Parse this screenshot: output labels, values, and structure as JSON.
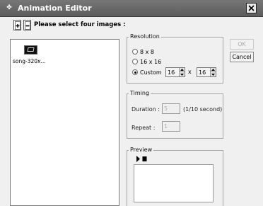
{
  "window": {
    "title": "Animation Editor",
    "title_icon": "animation-icon",
    "close_icon": "close-icon"
  },
  "toolbar": {
    "add_icon": "add-image-icon",
    "remove_icon": "remove-image-icon",
    "instruction": "Please select four images :"
  },
  "image_list": {
    "items": [
      {
        "label": "song-320x...",
        "icon": "image-thumbnail"
      }
    ]
  },
  "resolution": {
    "title": "Resolution",
    "options": [
      "8 x 8",
      "16 x 16",
      "Custom"
    ],
    "selected": "Custom",
    "custom_width": "16",
    "times": "x",
    "custom_height": "16"
  },
  "timing": {
    "title": "Timing",
    "duration_label": "Duration :",
    "duration_value": "5",
    "duration_unit": "(1/10 second)",
    "repeat_label": "Repeat  :",
    "repeat_value": "1"
  },
  "preview": {
    "title": "Preview",
    "play_icon": "play-icon",
    "stop_icon": "stop-icon"
  },
  "buttons": {
    "ok": "OK",
    "cancel": "Cancel"
  }
}
